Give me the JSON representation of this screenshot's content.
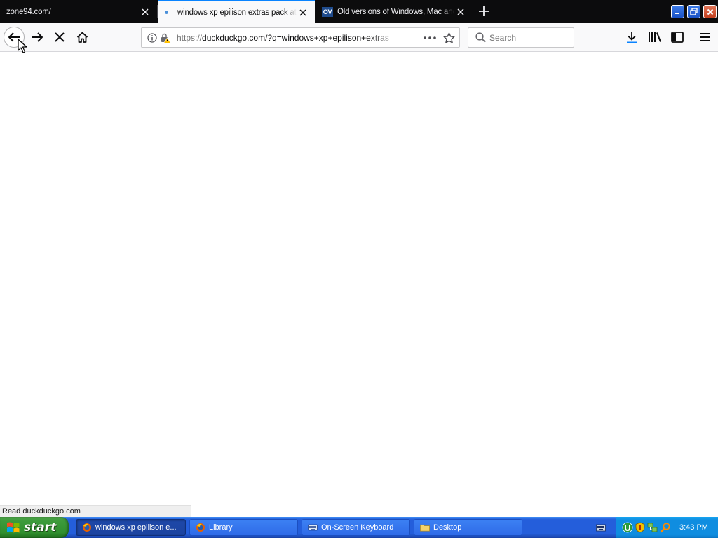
{
  "browser": {
    "tabs": [
      {
        "title": "zone94.com/",
        "active": false
      },
      {
        "title": "windows xp epilison extras pack at DuckDuckGo",
        "active": true
      },
      {
        "title": "Old versions of Windows, Mac and Linux software",
        "active": false,
        "favicon_text": "OV"
      }
    ],
    "url": {
      "scheme": "https://",
      "rest": "duckduckgo.com/?q=windows+xp+epilison+extras"
    },
    "search": {
      "placeholder": "Search"
    },
    "status_text": "Read duckduckgo.com",
    "accent_color": "#0a84ff"
  },
  "taskbar": {
    "start_label": "start",
    "tasks": [
      {
        "label": "windows xp epilison e...",
        "icon": "firefox-icon",
        "active": true
      },
      {
        "label": "Library",
        "icon": "library-icon",
        "active": false
      },
      {
        "label": "On-Screen Keyboard",
        "icon": "keyboard-icon",
        "active": false
      },
      {
        "label": "Desktop",
        "icon": "folder-icon",
        "active": false
      }
    ],
    "clock": "3:43 PM"
  }
}
